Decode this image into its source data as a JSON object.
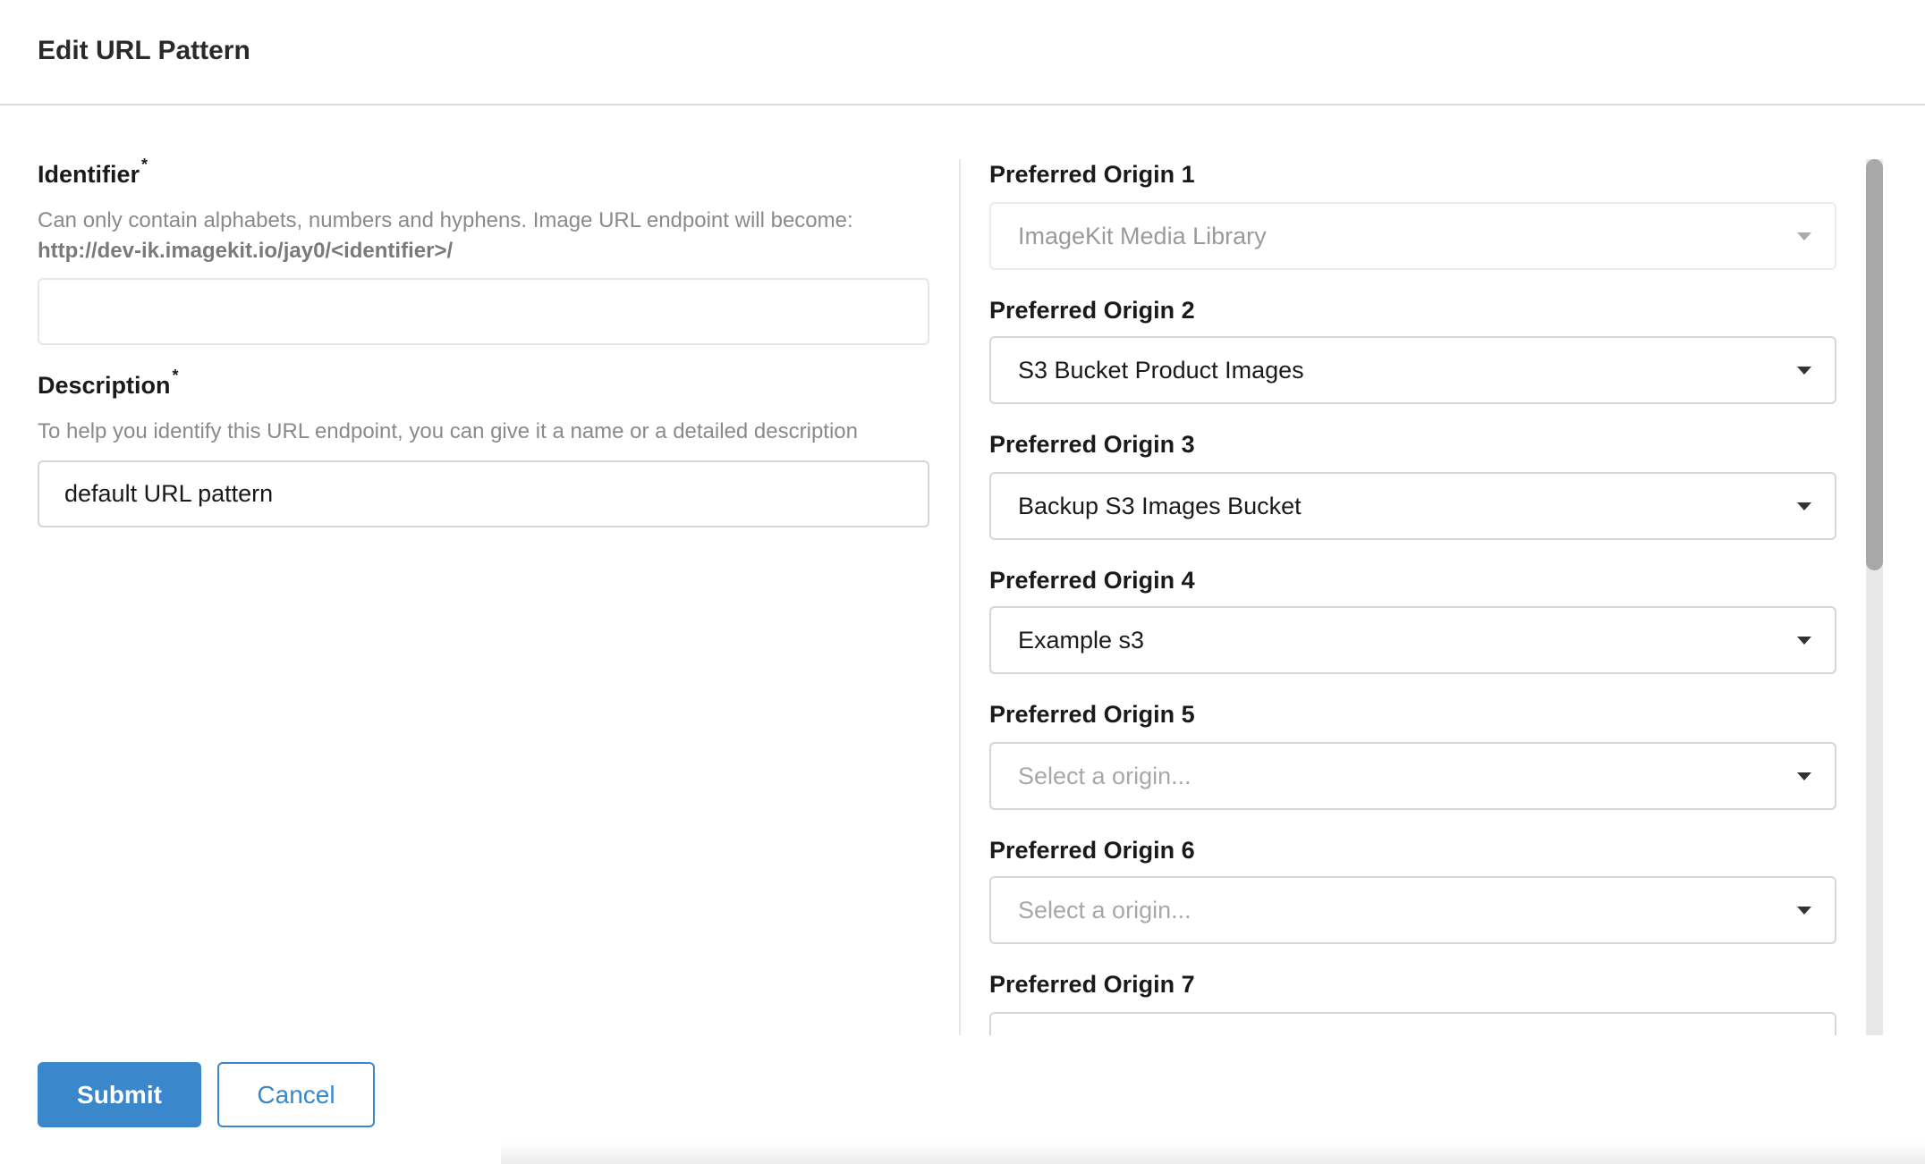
{
  "header": {
    "title": "Edit URL Pattern"
  },
  "identifier": {
    "label": "Identifier",
    "required_mark": "*",
    "help": "Can only contain alphabets, numbers and hyphens. Image URL endpoint will become:",
    "endpoint": "http://dev-ik.imagekit.io/jay0/<identifier>/",
    "value": ""
  },
  "description": {
    "label": "Description",
    "required_mark": "*",
    "help": "To help you identify this URL endpoint, you can give it a name or a detailed description",
    "value": "default URL pattern"
  },
  "origins": [
    {
      "label": "Preferred Origin 1",
      "value": "ImageKit Media Library",
      "state": "disabled"
    },
    {
      "label": "Preferred Origin 2",
      "value": "S3 Bucket Product Images",
      "state": "selected"
    },
    {
      "label": "Preferred Origin 3",
      "value": "Backup S3 Images Bucket",
      "state": "selected"
    },
    {
      "label": "Preferred Origin 4",
      "value": "Example s3",
      "state": "selected"
    },
    {
      "label": "Preferred Origin 5",
      "value": "Select a origin...",
      "state": "placeholder"
    },
    {
      "label": "Preferred Origin 6",
      "value": "Select a origin...",
      "state": "placeholder"
    },
    {
      "label": "Preferred Origin 7",
      "value": "",
      "state": "placeholder"
    }
  ],
  "actions": {
    "submit": "Submit",
    "cancel": "Cancel"
  },
  "colors": {
    "accent": "#3a87cc"
  }
}
